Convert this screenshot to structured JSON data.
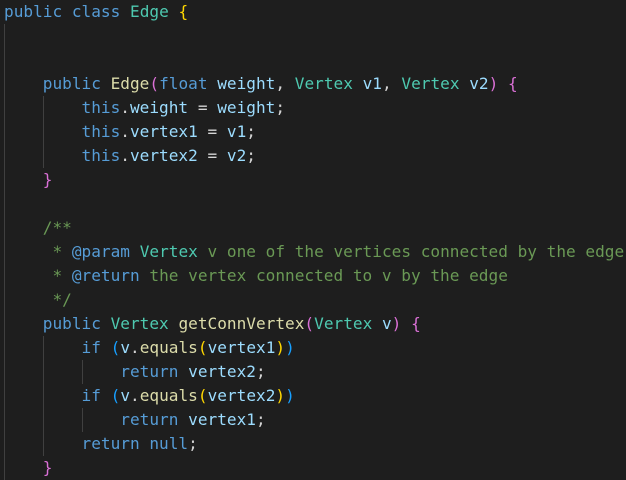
{
  "editor": {
    "theme": {
      "background": "#1e1e1e",
      "keyword": "#569cd6",
      "type": "#4ec9b0",
      "function": "#dcdcaa",
      "variable": "#9cdcfe",
      "text": "#d4d4d4",
      "comment": "#6a9955",
      "bracket_gold": "#ffd700",
      "bracket_purple": "#da70d6",
      "bracket_blue": "#179fff"
    },
    "lines": [
      [
        {
          "t": "public",
          "c": "kw"
        },
        {
          "t": " "
        },
        {
          "t": "class",
          "c": "kw"
        },
        {
          "t": " "
        },
        {
          "t": "Edge",
          "c": "cls"
        },
        {
          "t": " "
        },
        {
          "t": "{",
          "c": "br1"
        }
      ],
      [],
      [],
      [
        {
          "t": "    "
        },
        {
          "t": "public",
          "c": "kw"
        },
        {
          "t": " "
        },
        {
          "t": "Edge",
          "c": "fn"
        },
        {
          "t": "(",
          "c": "br2"
        },
        {
          "t": "float",
          "c": "kw"
        },
        {
          "t": " "
        },
        {
          "t": "weight",
          "c": "var"
        },
        {
          "t": ", "
        },
        {
          "t": "Vertex",
          "c": "cls"
        },
        {
          "t": " "
        },
        {
          "t": "v1",
          "c": "var"
        },
        {
          "t": ", "
        },
        {
          "t": "Vertex",
          "c": "cls"
        },
        {
          "t": " "
        },
        {
          "t": "v2",
          "c": "var"
        },
        {
          "t": ")",
          "c": "br2"
        },
        {
          "t": " "
        },
        {
          "t": "{",
          "c": "br2"
        }
      ],
      [
        {
          "t": "        "
        },
        {
          "t": "this",
          "c": "kw"
        },
        {
          "t": "."
        },
        {
          "t": "weight",
          "c": "var"
        },
        {
          "t": " = "
        },
        {
          "t": "weight",
          "c": "var"
        },
        {
          "t": ";"
        }
      ],
      [
        {
          "t": "        "
        },
        {
          "t": "this",
          "c": "kw"
        },
        {
          "t": "."
        },
        {
          "t": "vertex1",
          "c": "var"
        },
        {
          "t": " = "
        },
        {
          "t": "v1",
          "c": "var"
        },
        {
          "t": ";"
        }
      ],
      [
        {
          "t": "        "
        },
        {
          "t": "this",
          "c": "kw"
        },
        {
          "t": "."
        },
        {
          "t": "vertex2",
          "c": "var"
        },
        {
          "t": " = "
        },
        {
          "t": "v2",
          "c": "var"
        },
        {
          "t": ";"
        }
      ],
      [
        {
          "t": "    "
        },
        {
          "t": "}",
          "c": "br2"
        }
      ],
      [],
      [
        {
          "t": "    "
        },
        {
          "t": "/**",
          "c": "cmt"
        }
      ],
      [
        {
          "t": "     "
        },
        {
          "t": "* ",
          "c": "cmt"
        },
        {
          "t": "@param",
          "c": "kw"
        },
        {
          "t": " "
        },
        {
          "t": "Vertex",
          "c": "cls"
        },
        {
          "t": " "
        },
        {
          "t": "v one of the vertices connected by the edge",
          "c": "cmt"
        }
      ],
      [
        {
          "t": "     "
        },
        {
          "t": "* ",
          "c": "cmt"
        },
        {
          "t": "@return",
          "c": "kw"
        },
        {
          "t": " "
        },
        {
          "t": "the vertex connected to v by the edge",
          "c": "cmt"
        }
      ],
      [
        {
          "t": "     "
        },
        {
          "t": "*/",
          "c": "cmt"
        }
      ],
      [
        {
          "t": "    "
        },
        {
          "t": "public",
          "c": "kw"
        },
        {
          "t": " "
        },
        {
          "t": "Vertex",
          "c": "cls"
        },
        {
          "t": " "
        },
        {
          "t": "getConnVertex",
          "c": "fn"
        },
        {
          "t": "(",
          "c": "br2"
        },
        {
          "t": "Vertex",
          "c": "cls"
        },
        {
          "t": " "
        },
        {
          "t": "v",
          "c": "var"
        },
        {
          "t": ")",
          "c": "br2"
        },
        {
          "t": " "
        },
        {
          "t": "{",
          "c": "br2"
        }
      ],
      [
        {
          "t": "        "
        },
        {
          "t": "if",
          "c": "kw"
        },
        {
          "t": " "
        },
        {
          "t": "(",
          "c": "br3"
        },
        {
          "t": "v",
          "c": "var"
        },
        {
          "t": "."
        },
        {
          "t": "equals",
          "c": "fn"
        },
        {
          "t": "(",
          "c": "br1"
        },
        {
          "t": "vertex1",
          "c": "var"
        },
        {
          "t": ")",
          "c": "br1"
        },
        {
          "t": ")",
          "c": "br3"
        }
      ],
      [
        {
          "t": "            "
        },
        {
          "t": "return",
          "c": "kw"
        },
        {
          "t": " "
        },
        {
          "t": "vertex2",
          "c": "var"
        },
        {
          "t": ";"
        }
      ],
      [
        {
          "t": "        "
        },
        {
          "t": "if",
          "c": "kw"
        },
        {
          "t": " "
        },
        {
          "t": "(",
          "c": "br3"
        },
        {
          "t": "v",
          "c": "var"
        },
        {
          "t": "."
        },
        {
          "t": "equals",
          "c": "fn"
        },
        {
          "t": "(",
          "c": "br1"
        },
        {
          "t": "vertex2",
          "c": "var"
        },
        {
          "t": ")",
          "c": "br1"
        },
        {
          "t": ")",
          "c": "br3"
        }
      ],
      [
        {
          "t": "            "
        },
        {
          "t": "return",
          "c": "kw"
        },
        {
          "t": " "
        },
        {
          "t": "vertex1",
          "c": "var"
        },
        {
          "t": ";"
        }
      ],
      [
        {
          "t": "        "
        },
        {
          "t": "return",
          "c": "kw"
        },
        {
          "t": " "
        },
        {
          "t": "null",
          "c": "kw"
        },
        {
          "t": ";"
        }
      ],
      [
        {
          "t": "    "
        },
        {
          "t": "}",
          "c": "br2"
        }
      ]
    ]
  }
}
